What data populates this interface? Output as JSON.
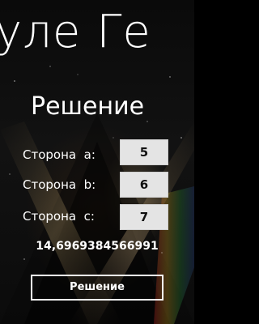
{
  "app": {
    "panorama_title": "уле Ге"
  },
  "page": {
    "title": "Решение"
  },
  "sides": [
    {
      "label": "Сторона  a:",
      "value": "5"
    },
    {
      "label": "Сторона  b:",
      "value": "6"
    },
    {
      "label": "Сторона  c:",
      "value": "7"
    }
  ],
  "result": {
    "value": "14,6969384566991"
  },
  "actions": {
    "solve_label": "Решение"
  },
  "colors": {
    "background": "#0b0b0b",
    "text": "#ffffff",
    "input_background": "#e4e4e4"
  }
}
